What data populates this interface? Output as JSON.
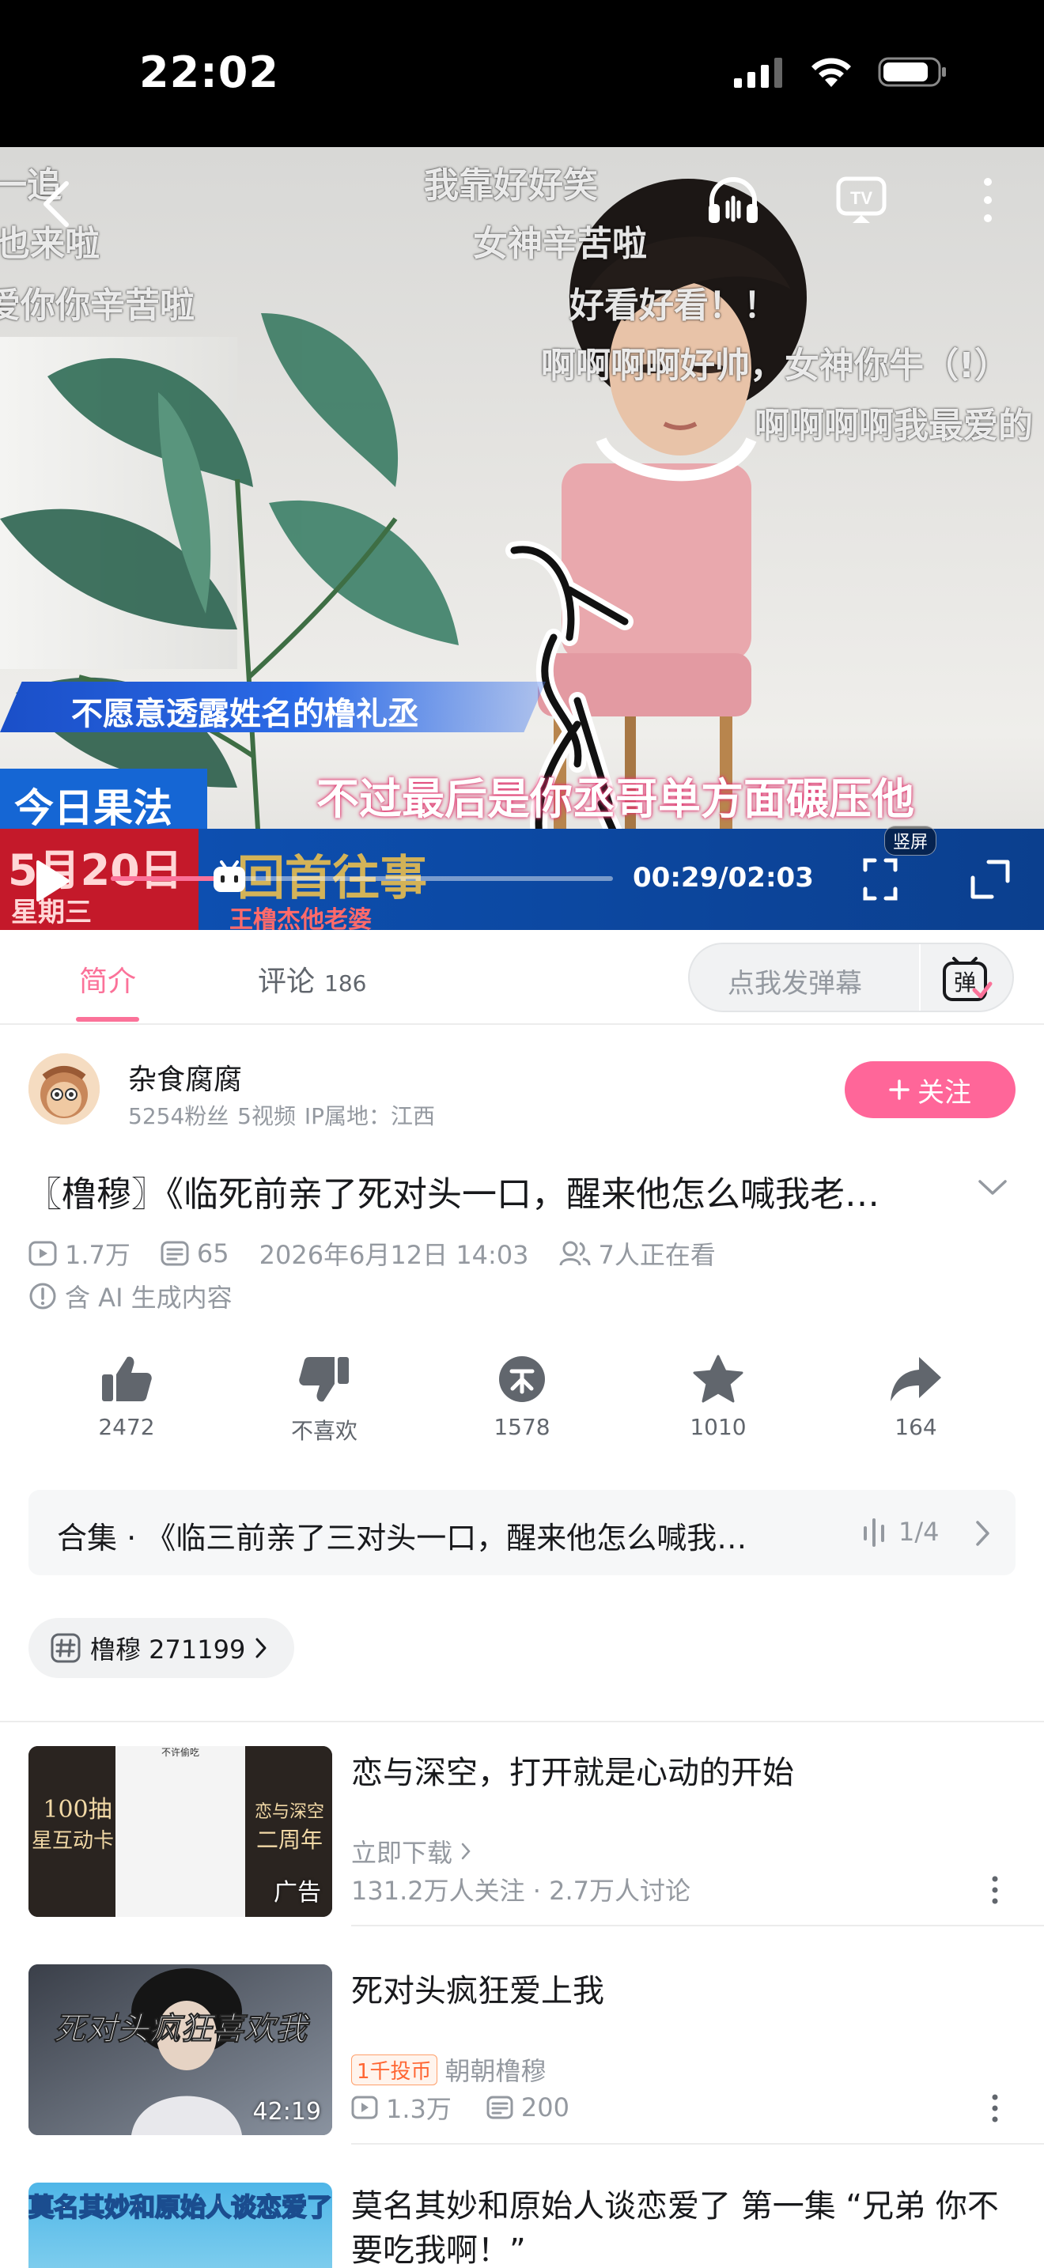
{
  "status_bar": {
    "time": "22:02"
  },
  "video": {
    "danmaku": [
      "一追",
      "我靠好好笑",
      "也来啦",
      "女神辛苦啦",
      "爱你你辛苦啦",
      "好看好看！！",
      "啊啊啊啊好帅，女神你牛（!）",
      "啊啊啊啊我最爱的"
    ],
    "news_banner": "不愿意透露姓名的橹礼丞",
    "subtitle": "不过最后是你丞哥单方面碾压他",
    "badge_today": "今日果法",
    "date_label": "5月20日",
    "weekday_label": "星期三",
    "band_title": "回首往事",
    "band_sub": "王橹杰他老婆",
    "time_readout": "00:29/02:03",
    "vertical_tag": "竖屏",
    "progress": 0.236
  },
  "tabs": {
    "intro": "简介",
    "comments": "评论",
    "comments_count": "186",
    "danmu_placeholder": "点我发弹幕",
    "danmu_icon_text": "弹"
  },
  "uploader": {
    "name": "杂食腐腐",
    "meta": "5254粉丝  5视频  IP属地：江西",
    "follow_label": "关注"
  },
  "video_info": {
    "title": "〖橹穆〗《临死前亲了死对头一口，醒来他怎么喊我老…",
    "views": "1.7万",
    "danmaku_count": "65",
    "date": "2026年6月12日 14:03",
    "watching": "7人正在看",
    "ai_note": "含 AI 生成内容"
  },
  "actions": [
    {
      "name": "like",
      "label": "2472"
    },
    {
      "name": "dislike",
      "label": "不喜欢"
    },
    {
      "name": "coin",
      "label": "1578"
    },
    {
      "name": "favorite",
      "label": "1010"
    },
    {
      "name": "share",
      "label": "164"
    }
  ],
  "collection": {
    "text": "合集 · 《临三前亲了三对头一口，醒来他怎么喊我…",
    "count": "1/4"
  },
  "tag": {
    "label": "橹穆 271199"
  },
  "feed": [
    {
      "title": "恋与深空，打开就是心动的开始",
      "thumb_badge": "广告",
      "thumb_text_left": "100抽",
      "thumb_text_left2": "星互动卡",
      "thumb_text_right": "恋与深空",
      "thumb_text_right2": "二周年",
      "thumb_top": "不许偷吃",
      "line2": "立即下载",
      "line3": "131.2万人关注 · 2.7万人讨论"
    },
    {
      "title": "死对头疯狂爱上我",
      "thumb_badge": "42:19",
      "thumb_text": "死对头疯狂喜欢我",
      "coin_tag": "1千投币",
      "author": "朝朝橹穆",
      "views": "1.3万",
      "danmaku": "200"
    },
    {
      "title": "莫名其妙和原始人谈恋爱了 第一集 “兄弟 你不要吃我啊！”",
      "thumb_text": "莫名其妙和原始人谈恋爱了"
    }
  ],
  "colors": {
    "accent": "#fb7299",
    "follow": "#ff6699",
    "muted": "#9499a0"
  }
}
